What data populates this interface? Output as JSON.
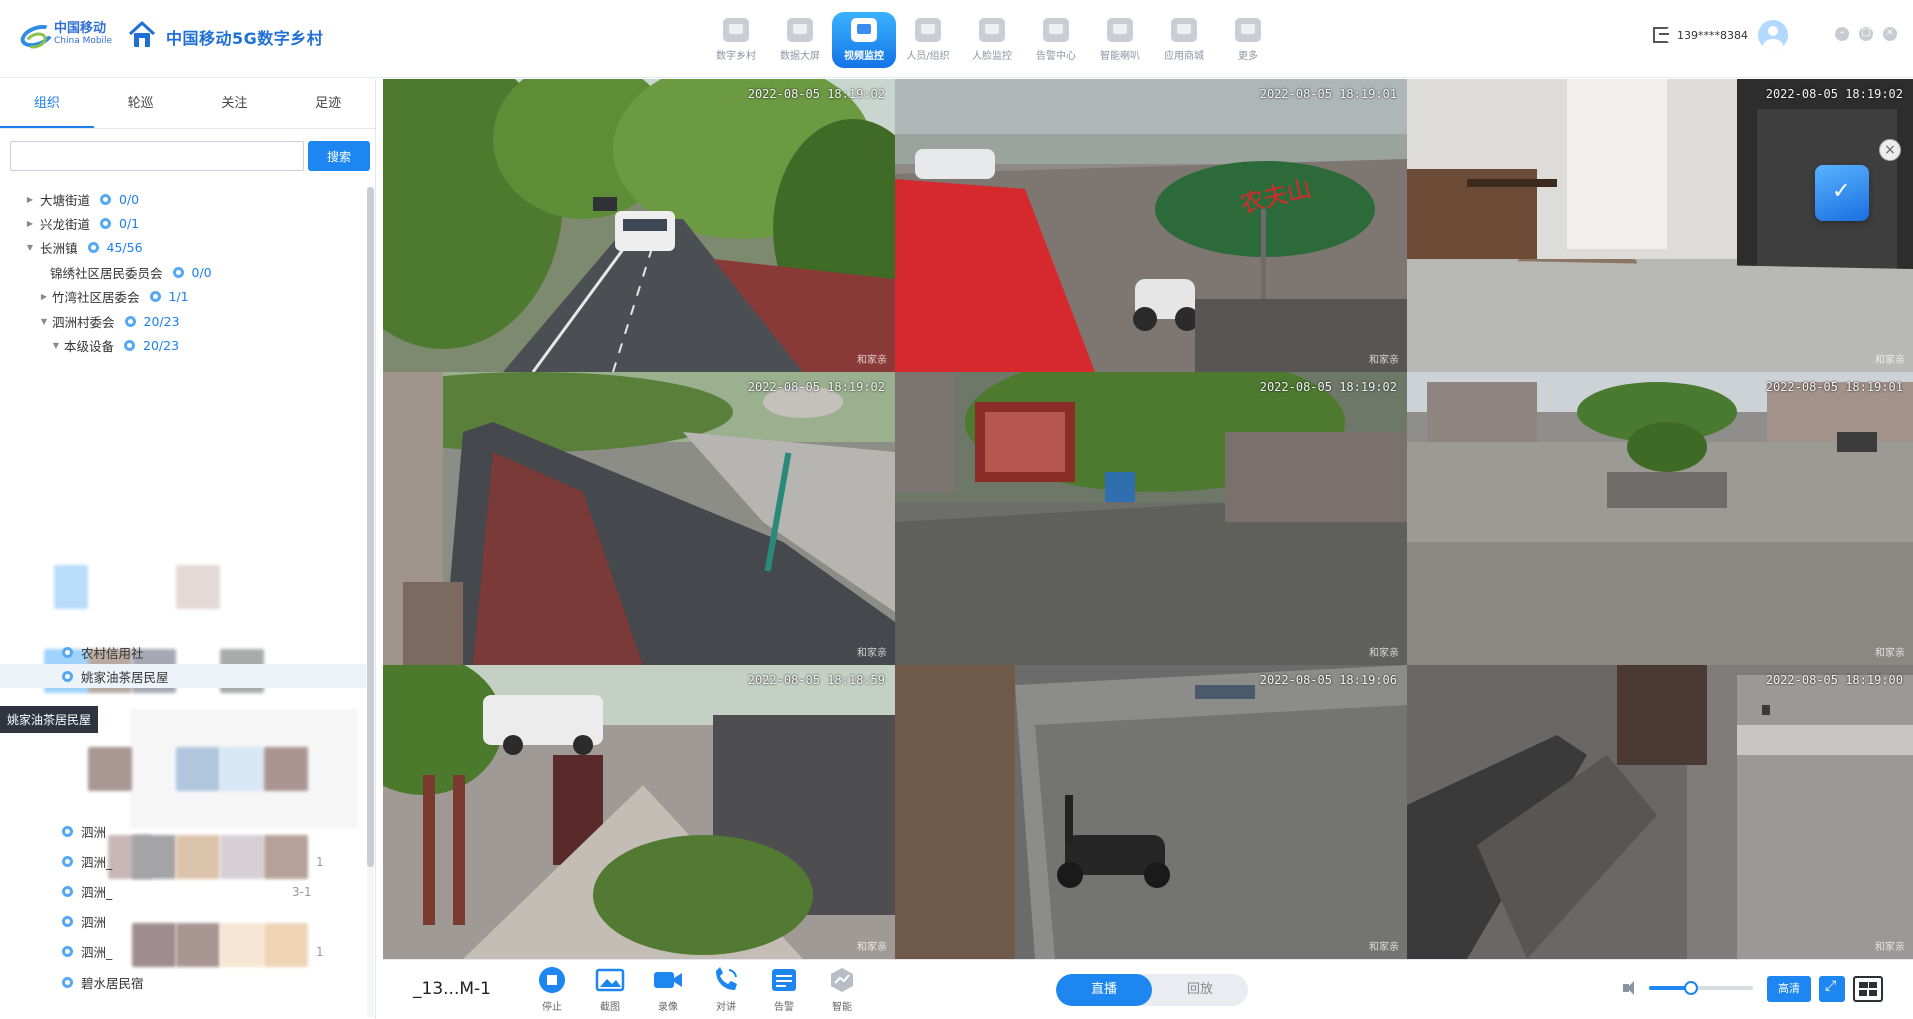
{
  "header": {
    "brand_cn": "中国移动",
    "brand_en": "China Mobile",
    "app_title": "中国移动5G数字乡村",
    "nav": [
      {
        "label": "数字乡村",
        "icon": "village-icon"
      },
      {
        "label": "数据大屏",
        "icon": "dashboard-icon"
      },
      {
        "label": "视频监控",
        "icon": "camera-icon",
        "active": true
      },
      {
        "label": "人员/组织",
        "icon": "people-icon"
      },
      {
        "label": "人脸监控",
        "icon": "face-icon"
      },
      {
        "label": "告警中心",
        "icon": "alarm-icon"
      },
      {
        "label": "智能喇叭",
        "icon": "speaker-icon"
      },
      {
        "label": "应用商城",
        "icon": "store-icon"
      },
      {
        "label": "更多",
        "icon": "more-icon"
      }
    ],
    "user_phone": "139****8384"
  },
  "sidebar": {
    "tabs": [
      "组织",
      "轮巡",
      "关注",
      "足迹"
    ],
    "active_tab": "组织",
    "search": {
      "value": "",
      "placeholder": "",
      "button": "搜索"
    },
    "tree": [
      {
        "name": "大塘街道",
        "count": "0/0"
      },
      {
        "name": "兴龙街道",
        "count": "0/1"
      },
      {
        "name": "长洲镇",
        "count": "45/56"
      },
      {
        "name": "锦绣社区居民委员会",
        "count": "0/0"
      },
      {
        "name": "竹湾社区居委会",
        "count": "1/1"
      },
      {
        "name": "泗洲村委会",
        "count": "20/23"
      },
      {
        "name": "本级设备",
        "count": "20/23"
      },
      {
        "name": "农村信用社"
      },
      {
        "name": "姚家油茶居民屋"
      },
      {
        "name": "碧水居民宿"
      }
    ],
    "partial_rows": [
      "泗洲",
      "泗洲_",
      "泗洲_",
      "泗洲",
      "泗洲_"
    ],
    "partial_suffixes": [
      "1",
      "3-1",
      "1"
    ],
    "tooltip": "姚家油茶居民屋"
  },
  "cameras": [
    {
      "timestamp": "2022-08-05 18:19:02",
      "watermark": "和家亲",
      "active": true
    },
    {
      "timestamp": "2022-08-05 18:19:01",
      "watermark": "和家亲"
    },
    {
      "timestamp": "2022-08-05 18:19:02",
      "watermark": "和家亲"
    },
    {
      "timestamp": "2022-08-05 18:19:02",
      "watermark": "和家亲"
    },
    {
      "timestamp": "2022-08-05 18:19:02",
      "watermark": "和家亲"
    },
    {
      "timestamp": "2022-08-05 18:19:01",
      "watermark": "和家亲"
    },
    {
      "timestamp": "2022-08-05 18:18:59",
      "watermark": "和家亲"
    },
    {
      "timestamp": "2022-08-05 18:19:06",
      "watermark": "和家亲"
    },
    {
      "timestamp": "2022-08-05 18:19:00",
      "watermark": "和家亲"
    }
  ],
  "umbrella_text": "农夫山",
  "toolbar": {
    "camera_name": "_13...M-1",
    "tools": [
      {
        "label": "停止",
        "icon": "stop-icon"
      },
      {
        "label": "截图",
        "icon": "screenshot-icon"
      },
      {
        "label": "录像",
        "icon": "record-icon"
      },
      {
        "label": "对讲",
        "icon": "intercom-icon"
      },
      {
        "label": "告警",
        "icon": "alarm-icon"
      },
      {
        "label": "智能",
        "icon": "smart-icon"
      }
    ],
    "modes": [
      "直播",
      "回放"
    ],
    "active_mode": "直播",
    "volume": 0.4,
    "quality": "高清"
  },
  "colors": {
    "accent": "#1d86f0",
    "nav_active": "#1573e8",
    "tree_count": "#1d7ff0"
  }
}
